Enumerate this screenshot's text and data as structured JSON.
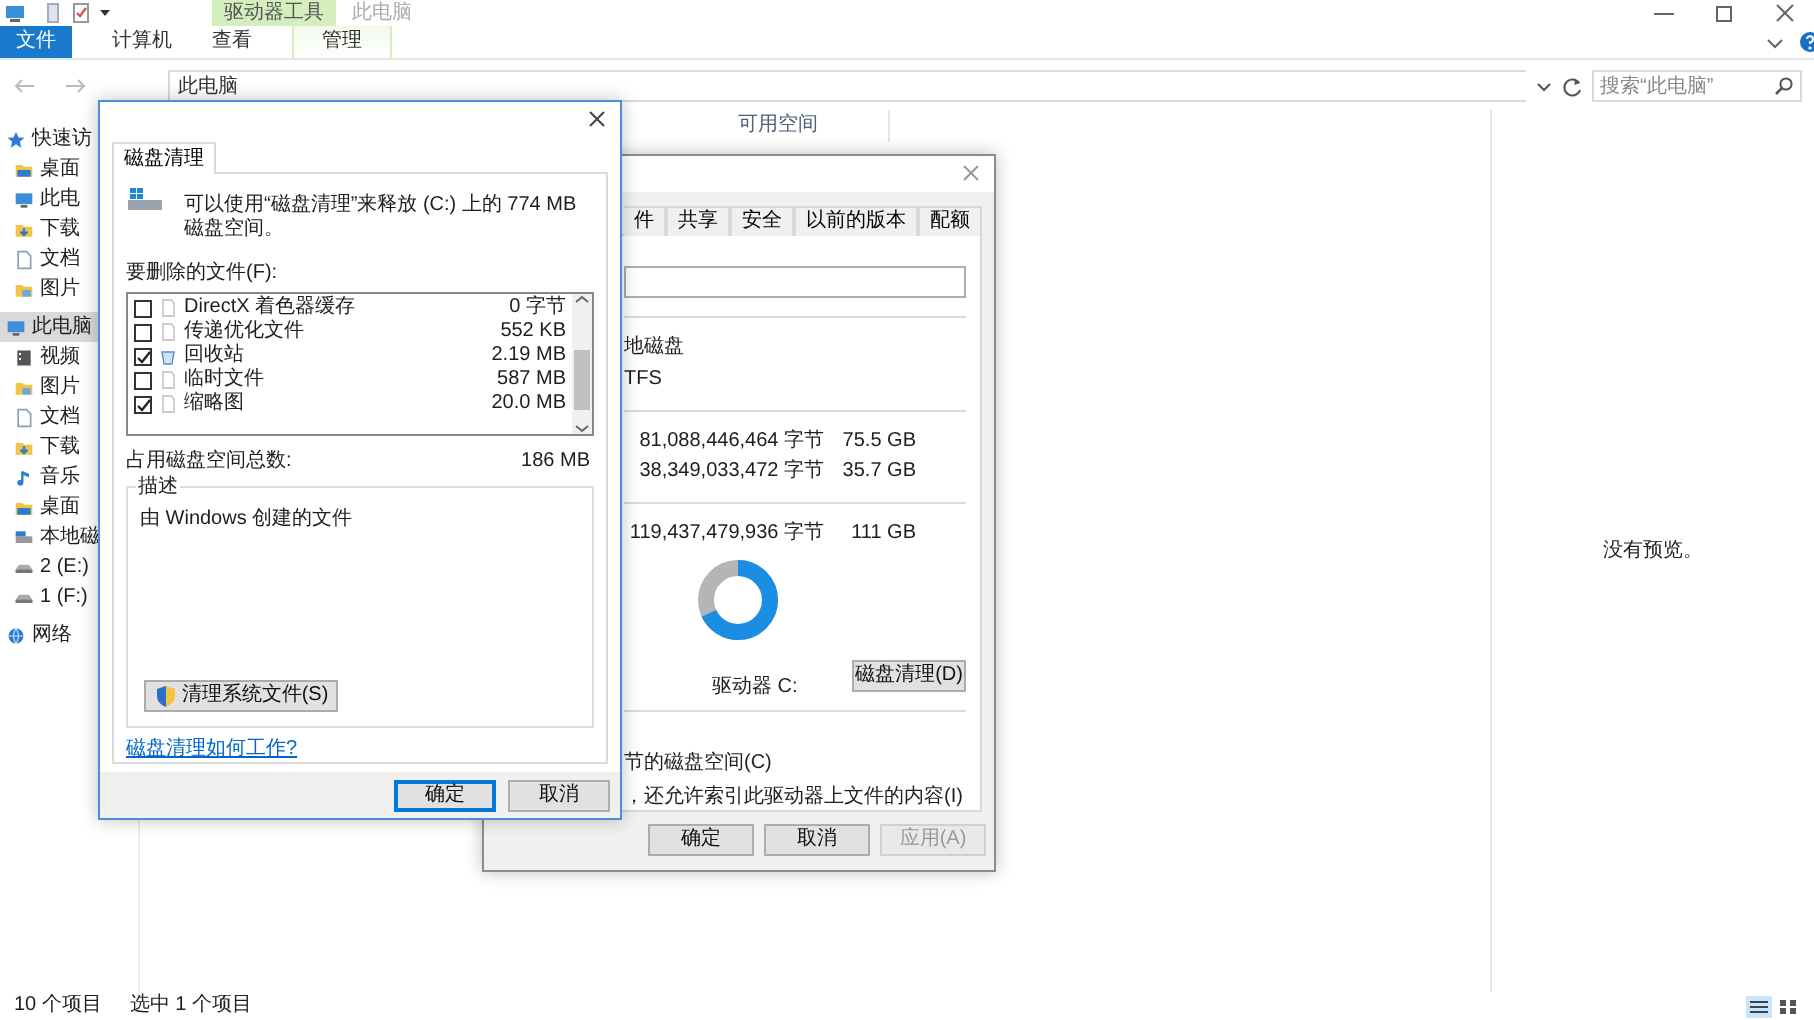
{
  "explorer": {
    "context_group": "驱动器工具",
    "title": "此电脑",
    "ribbon_tabs": [
      {
        "label": "文件",
        "kind": "file",
        "selected": false
      },
      {
        "label": "计算机",
        "kind": "tab",
        "selected": false
      },
      {
        "label": "查看",
        "kind": "tab",
        "selected": false
      },
      {
        "label": "管理",
        "kind": "context",
        "selected": false
      }
    ],
    "address": "此电脑",
    "search_placeholder": "搜索“此电脑”",
    "nav": [
      {
        "label": "快速访",
        "kind": "star",
        "selected": false,
        "children": [
          {
            "label": "桌面",
            "kind": "desktop",
            "selected": false
          },
          {
            "label": "此电",
            "kind": "pc",
            "selected": false
          },
          {
            "label": "下载",
            "kind": "download",
            "selected": false
          },
          {
            "label": "文档",
            "kind": "doc",
            "selected": false
          },
          {
            "label": "图片",
            "kind": "picture",
            "selected": false
          }
        ]
      },
      {
        "label": "此电脑",
        "kind": "pc",
        "selected": true,
        "children": [
          {
            "label": "视频",
            "kind": "video",
            "selected": false
          },
          {
            "label": "图片",
            "kind": "picture",
            "selected": false
          },
          {
            "label": "文档",
            "kind": "doc",
            "selected": false
          },
          {
            "label": "下载",
            "kind": "download",
            "selected": false
          },
          {
            "label": "音乐",
            "kind": "music",
            "selected": false
          },
          {
            "label": "桌面",
            "kind": "desktop",
            "selected": false
          },
          {
            "label": "本地磁",
            "kind": "disk",
            "selected": false
          },
          {
            "label": "2 (E:)",
            "kind": "drive",
            "selected": false
          },
          {
            "label": "1 (F:)",
            "kind": "drive",
            "selected": false
          }
        ]
      },
      {
        "label": "网络",
        "kind": "network",
        "selected": false
      }
    ],
    "column_header": "可用空间",
    "preview_text": "没有预览。",
    "status": [
      "10 个项目",
      "选中 1 个项目"
    ]
  },
  "cleanup": {
    "tabs": [
      {
        "label": "磁盘清理",
        "selected": true
      }
    ],
    "intro": "可以使用“磁盘清理”来释放 (C:) 上的 774 MB 磁盘空间。",
    "files_label": "要删除的文件(F):",
    "files": [
      {
        "label": "DirectX 着色器缓存",
        "size": "0 字节",
        "checked": false,
        "kind": "file"
      },
      {
        "label": "传递优化文件",
        "size": "552 KB",
        "checked": false,
        "kind": "file"
      },
      {
        "label": "回收站",
        "size": "2.19 MB",
        "checked": true,
        "kind": "recycle"
      },
      {
        "label": "临时文件",
        "size": "587 MB",
        "checked": false,
        "kind": "file"
      },
      {
        "label": "缩略图",
        "size": "20.0 MB",
        "checked": true,
        "kind": "file"
      }
    ],
    "total_label": "占用磁盘空间总数:",
    "total": "186 MB",
    "description_title": "描述",
    "description": "由 Windows 创建的文件",
    "system_button": "清理系统文件(S)",
    "help_link": "磁盘清理如何工作?",
    "buttons": [
      {
        "label": "确定",
        "default": true
      },
      {
        "label": "取消",
        "default": false
      }
    ]
  },
  "properties": {
    "tabs": [
      {
        "label": "件",
        "selected": false
      },
      {
        "label": "共享",
        "selected": false
      },
      {
        "label": "安全",
        "selected": false
      },
      {
        "label": "以前的版本",
        "selected": false
      },
      {
        "label": "配额",
        "selected": false
      }
    ],
    "type": "地磁盘",
    "filesystem": "TFS",
    "rows": [
      {
        "bytes": "81,088,446,464 字节",
        "size": "75.5 GB"
      },
      {
        "bytes": "38,349,033,472 字节",
        "size": "35.7 GB"
      }
    ],
    "capacity": {
      "bytes": "119,437,479,936 字节",
      "size": "111 GB"
    },
    "usage": {
      "level": 0.68
    },
    "drive_label": "驱动器 C:",
    "cleanup_button": "磁盘清理(D)",
    "options": [
      "节的磁盘空间(C)",
      "，还允许索引此驱动器上文件的内容(I)"
    ],
    "buttons": [
      {
        "label": "确定",
        "disabled": false
      },
      {
        "label": "取消",
        "disabled": false
      },
      {
        "label": "应用(A)",
        "disabled": true
      }
    ]
  }
}
